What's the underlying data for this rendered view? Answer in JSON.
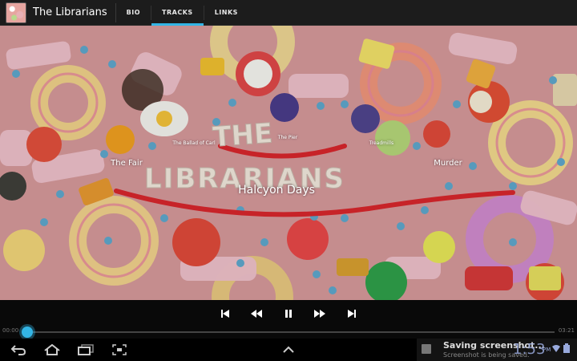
{
  "app": {
    "title": "The Librarians",
    "tabs": [
      {
        "label": "BIO",
        "active": false
      },
      {
        "label": "TRACKS",
        "active": true
      },
      {
        "label": "LINKS",
        "active": false
      }
    ]
  },
  "tracks": {
    "small": [
      "The Ballad of Carl",
      "The Pier",
      "Treadmills"
    ],
    "medium": [
      "The Fair",
      "Murder"
    ],
    "large": [
      "Halcyon Days"
    ]
  },
  "player": {
    "elapsed": "00:00",
    "total": "03:21",
    "progress": 0.0,
    "playing": true
  },
  "notification": {
    "title": "Saving screenshot...",
    "subtitle": "Screenshot is being saved."
  },
  "status": {
    "time": "1:53",
    "ampm": "PM"
  },
  "colors": {
    "accent": "#33b5e5",
    "artwork_bg": "#d5999a"
  },
  "icons": {
    "controls": [
      "skip-previous-icon",
      "rewind-icon",
      "pause-icon",
      "fast-forward-icon",
      "skip-next-icon"
    ],
    "nav": [
      "back-icon",
      "home-icon",
      "recent-apps-icon",
      "screenshot-icon",
      "up-chevron-icon"
    ]
  }
}
